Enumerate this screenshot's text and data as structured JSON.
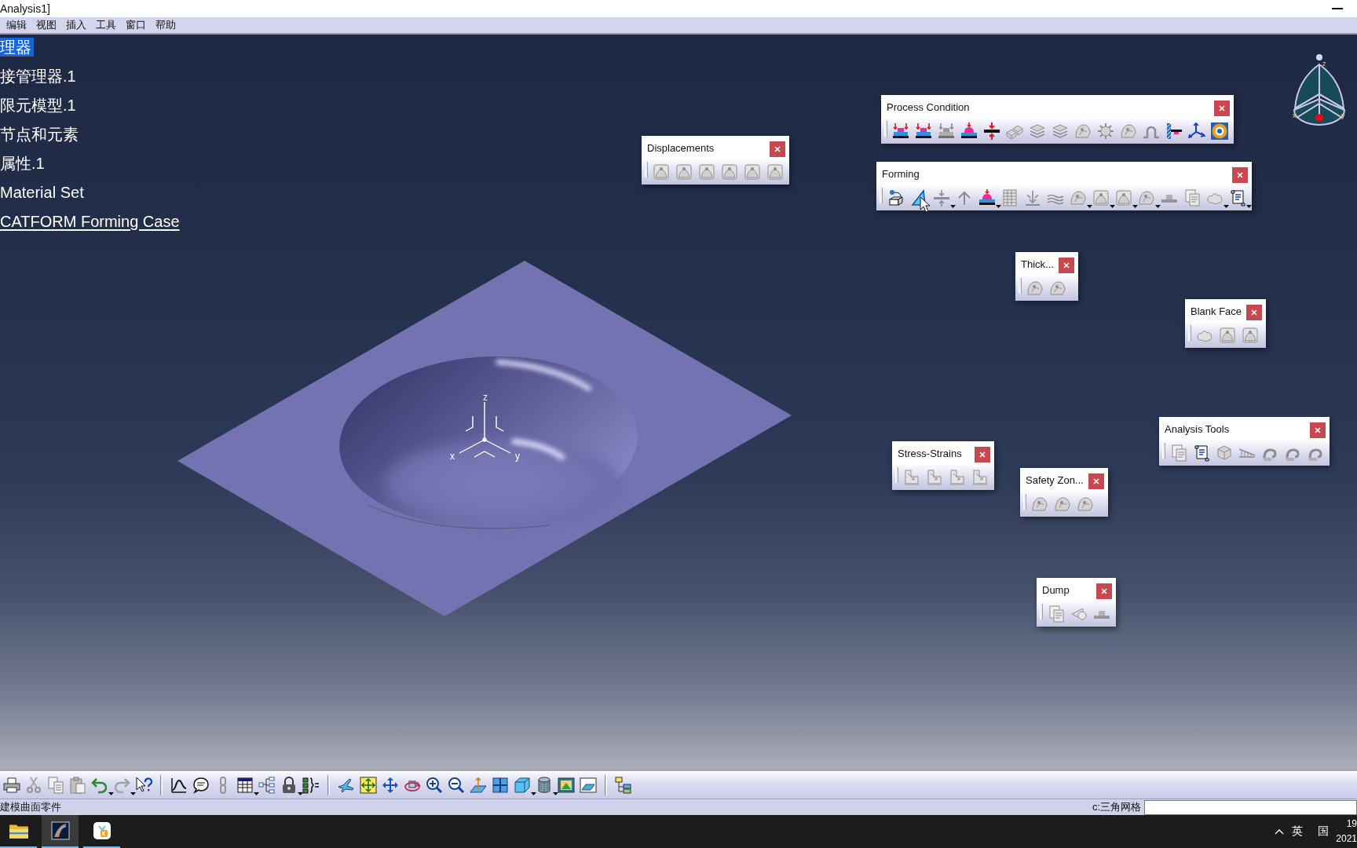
{
  "window": {
    "title": "Analysis1]"
  },
  "menu_bar": [
    "编辑",
    "视图",
    "插入",
    "工具",
    "窗口",
    "帮助"
  ],
  "tree": [
    {
      "label": "理器",
      "selected": true,
      "current": false
    },
    {
      "label": "接管理器.1",
      "selected": false,
      "current": false
    },
    {
      "label": "限元模型.1",
      "selected": false,
      "current": false
    },
    {
      "label": "节点和元素",
      "selected": false,
      "current": false
    },
    {
      "label": "属性.1",
      "selected": false,
      "current": false
    },
    {
      "label": "Material Set",
      "selected": false,
      "current": false
    },
    {
      "label": "CATFORM Forming Case",
      "selected": false,
      "current": true
    }
  ],
  "viewport": {
    "triad": {
      "x_label": "x",
      "y_label": "y",
      "z_label": "z"
    },
    "compass": {
      "x_label": "x",
      "y_label": "y",
      "z_label": "z"
    }
  },
  "toolbars": [
    {
      "title": "Process Condition",
      "tools": [
        {
          "disabled": false,
          "dropdown": false
        },
        {
          "disabled": false,
          "dropdown": false
        },
        {
          "disabled": true,
          "dropdown": false
        },
        {
          "disabled": false,
          "dropdown": false
        },
        {
          "disabled": false,
          "dropdown": false
        },
        {
          "disabled": true,
          "dropdown": false
        },
        {
          "disabled": true,
          "dropdown": false
        },
        {
          "disabled": true,
          "dropdown": false
        },
        {
          "disabled": true,
          "dropdown": false
        },
        {
          "disabled": true,
          "dropdown": false
        },
        {
          "disabled": true,
          "dropdown": false
        },
        {
          "disabled": true,
          "dropdown": false
        },
        {
          "disabled": false,
          "dropdown": false
        },
        {
          "disabled": false,
          "dropdown": false
        },
        {
          "disabled": false,
          "dropdown": false
        }
      ]
    },
    {
      "title": "Displacements",
      "tools": [
        {
          "disabled": true,
          "dropdown": false
        },
        {
          "disabled": true,
          "dropdown": false
        },
        {
          "disabled": true,
          "dropdown": false
        },
        {
          "disabled": true,
          "dropdown": false
        },
        {
          "disabled": true,
          "dropdown": false
        },
        {
          "disabled": true,
          "dropdown": false
        }
      ]
    },
    {
      "title": "Forming",
      "tools": [
        {
          "disabled": false,
          "dropdown": false
        },
        {
          "disabled": false,
          "dropdown": false
        },
        {
          "disabled": true,
          "dropdown": true
        },
        {
          "disabled": true,
          "dropdown": false
        },
        {
          "disabled": false,
          "dropdown": true
        },
        {
          "disabled": true,
          "dropdown": false
        },
        {
          "disabled": true,
          "dropdown": false
        },
        {
          "disabled": true,
          "dropdown": false
        },
        {
          "disabled": true,
          "dropdown": true
        },
        {
          "disabled": true,
          "dropdown": true
        },
        {
          "disabled": true,
          "dropdown": true
        },
        {
          "disabled": true,
          "dropdown": true
        },
        {
          "disabled": true,
          "dropdown": false
        },
        {
          "disabled": true,
          "dropdown": false
        },
        {
          "disabled": true,
          "dropdown": true
        },
        {
          "disabled": false,
          "dropdown": true
        }
      ]
    },
    {
      "title": "Thick...",
      "tools": [
        {
          "disabled": true,
          "dropdown": false
        },
        {
          "disabled": true,
          "dropdown": false
        }
      ]
    },
    {
      "title": "Blank Face",
      "tools": [
        {
          "disabled": true,
          "dropdown": false
        },
        {
          "disabled": true,
          "dropdown": false
        },
        {
          "disabled": true,
          "dropdown": false
        }
      ]
    },
    {
      "title": "Analysis Tools",
      "tools": [
        {
          "disabled": true,
          "dropdown": false
        },
        {
          "disabled": false,
          "dropdown": false
        },
        {
          "disabled": true,
          "dropdown": false
        },
        {
          "disabled": true,
          "dropdown": false
        },
        {
          "disabled": true,
          "dropdown": false
        },
        {
          "disabled": true,
          "dropdown": false
        },
        {
          "disabled": true,
          "dropdown": false
        }
      ]
    },
    {
      "title": "Stress-Strains",
      "tools": [
        {
          "disabled": true,
          "dropdown": false
        },
        {
          "disabled": true,
          "dropdown": false
        },
        {
          "disabled": true,
          "dropdown": false
        },
        {
          "disabled": true,
          "dropdown": false
        }
      ]
    },
    {
      "title": "Safety Zon...",
      "tools": [
        {
          "disabled": true,
          "dropdown": false
        },
        {
          "disabled": true,
          "dropdown": false
        },
        {
          "disabled": true,
          "dropdown": false
        }
      ]
    },
    {
      "title": "Dump",
      "tools": [
        {
          "disabled": true,
          "dropdown": false
        },
        {
          "disabled": true,
          "dropdown": false
        },
        {
          "disabled": true,
          "dropdown": false
        }
      ]
    }
  ],
  "standard_toolbar": {
    "groups": [
      {
        "tools": [
          {
            "disabled": false,
            "dropdown": false
          },
          {
            "disabled": true,
            "dropdown": false
          },
          {
            "disabled": true,
            "dropdown": false
          },
          {
            "disabled": true,
            "dropdown": false
          },
          {
            "disabled": false,
            "dropdown": true
          },
          {
            "disabled": true,
            "dropdown": true
          },
          {
            "disabled": false,
            "dropdown": false
          }
        ]
      },
      {
        "tools": [
          {
            "disabled": false,
            "dropdown": false
          },
          {
            "disabled": false,
            "dropdown": false
          },
          {
            "disabled": true,
            "dropdown": false
          },
          {
            "disabled": false,
            "dropdown": true
          },
          {
            "disabled": false,
            "dropdown": false
          },
          {
            "disabled": false,
            "dropdown": true
          },
          {
            "disabled": false,
            "dropdown": false
          }
        ]
      },
      {
        "tools": [
          {
            "disabled": false,
            "dropdown": false
          },
          {
            "disabled": false,
            "dropdown": false
          },
          {
            "disabled": false,
            "dropdown": false
          },
          {
            "disabled": false,
            "dropdown": false
          },
          {
            "disabled": false,
            "dropdown": false
          },
          {
            "disabled": false,
            "dropdown": false
          },
          {
            "disabled": false,
            "dropdown": false
          },
          {
            "disabled": false,
            "dropdown": false
          },
          {
            "disabled": false,
            "dropdown": true
          },
          {
            "disabled": false,
            "dropdown": true
          },
          {
            "disabled": false,
            "dropdown": false
          },
          {
            "disabled": false,
            "dropdown": false
          }
        ]
      },
      {
        "tools": [
          {
            "disabled": false,
            "dropdown": false
          }
        ]
      }
    ]
  },
  "status_bar": {
    "message": "建模曲面零件",
    "field_label": "c:三角网格"
  },
  "taskbar": {
    "apps": [
      {
        "selected": false,
        "running": true
      },
      {
        "selected": true,
        "running": true
      },
      {
        "selected": false,
        "running": true
      }
    ],
    "input_language": "英",
    "ime_mode": "国",
    "clock": {
      "time": "19",
      "date": "2021"
    }
  }
}
